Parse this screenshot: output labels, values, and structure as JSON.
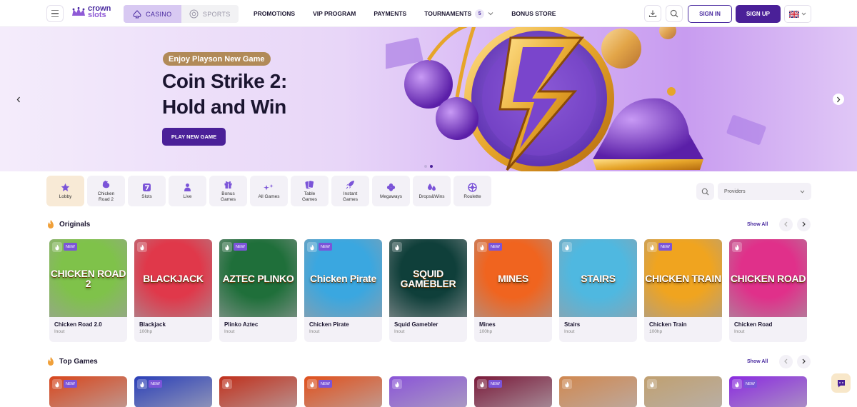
{
  "header": {
    "logo": {
      "line1": "crown",
      "line2": "slots"
    },
    "switch": [
      {
        "label": "CASINO",
        "active": true
      },
      {
        "label": "SPORTS",
        "active": false
      }
    ],
    "nav": [
      {
        "label": "PROMOTIONS"
      },
      {
        "label": "VIP PROGRAM"
      },
      {
        "label": "PAYMENTS"
      },
      {
        "label": "TOURNAMENTS",
        "badge": "5"
      },
      {
        "label": "BONUS STORE"
      }
    ],
    "signin": "SIGN IN",
    "signup": "SIGN UP",
    "language_icon": "uk-flag-icon"
  },
  "hero": {
    "tag": "Enjoy Playson New Game",
    "title": "Coin Strike 2: Hold and Win",
    "button": "PLAY NEW GAME"
  },
  "categories": [
    {
      "label": "Lobby",
      "icon": "star-icon",
      "active": true
    },
    {
      "label": "Chicken Road 2",
      "icon": "chicken-icon"
    },
    {
      "label": "Slots",
      "icon": "seven-icon"
    },
    {
      "label": "Live",
      "icon": "dealer-icon"
    },
    {
      "label": "Bonus Games",
      "icon": "gift-icon"
    },
    {
      "label": "All Games",
      "icon": "stars-icon"
    },
    {
      "label": "Table Games",
      "icon": "cards-icon"
    },
    {
      "label": "Instant Games",
      "icon": "rocket-icon"
    },
    {
      "label": "Megaways",
      "icon": "clover-icon"
    },
    {
      "label": "Drops&Wins",
      "icon": "drops-icon"
    },
    {
      "label": "Roulette",
      "icon": "roulette-icon"
    }
  ],
  "providers_placeholder": "Providers",
  "originals": {
    "title": "Originals",
    "show_all": "Show All",
    "games": [
      {
        "name": "Chicken Road 2.0",
        "provider": "Inout",
        "art": "CHICKEN ROAD 2",
        "bg": "#7fc24a",
        "new": true
      },
      {
        "name": "Blackjack",
        "provider": "100hp",
        "art": "BLACKJACK",
        "bg": "#e0384a",
        "new": false
      },
      {
        "name": "Plinko Aztec",
        "provider": "Inout",
        "art": "AZTEC PLINKO",
        "bg": "#1f6f3a",
        "new": true
      },
      {
        "name": "Chicken Pirate",
        "provider": "Inout",
        "art": "Chicken Pirate",
        "bg": "#3aa7e0",
        "new": true
      },
      {
        "name": "Squid Gamebler",
        "provider": "Inout",
        "art": "SQUID GAMEBLER",
        "bg": "#0f3f3a",
        "new": false
      },
      {
        "name": "Mines",
        "provider": "100hp",
        "art": "MINES",
        "bg": "#f0641f",
        "new": true
      },
      {
        "name": "Stairs",
        "provider": "Inout",
        "art": "STAIRS",
        "bg": "#4fb8e0",
        "new": false
      },
      {
        "name": "Chicken Train",
        "provider": "100hp",
        "art": "CHICKEN TRAIN",
        "bg": "#f0a41f",
        "new": true
      },
      {
        "name": "Chicken Road",
        "provider": "Inout",
        "art": "CHICKEN ROAD",
        "bg": "#e0308a",
        "new": false
      }
    ]
  },
  "top_games": {
    "title": "Top Games",
    "show_all": "Show All",
    "thumbs": [
      {
        "bg": "#d8461c",
        "new": true
      },
      {
        "bg": "#2a3fb8",
        "new": true
      },
      {
        "bg": "#c0301c",
        "new": false
      },
      {
        "bg": "#e0501c",
        "new": true
      },
      {
        "bg": "#8a54d8",
        "new": false
      },
      {
        "bg": "#7a1a3a",
        "new": true
      },
      {
        "bg": "#d08850",
        "new": false
      },
      {
        "bg": "#c0a070",
        "new": false
      },
      {
        "bg": "#8a2ae0",
        "new": true
      }
    ]
  },
  "new_label": "NEW"
}
